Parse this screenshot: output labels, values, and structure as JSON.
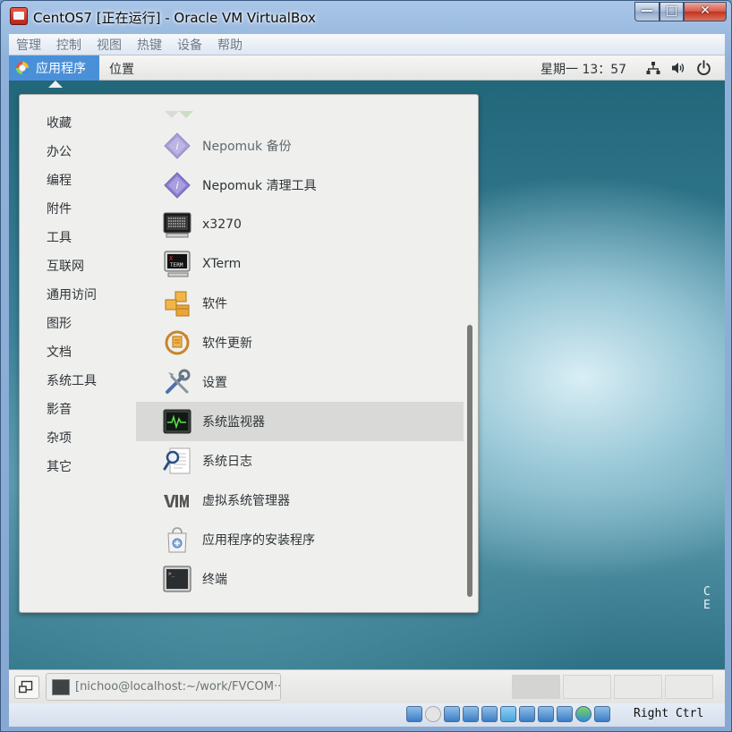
{
  "window": {
    "title": "CentOS7 [正在运行] - Oracle VM VirtualBox",
    "controls": {
      "minimize": "—",
      "maximize": "□",
      "close": "✕"
    }
  },
  "vbox_menu": [
    "管理",
    "控制",
    "视图",
    "热键",
    "设备",
    "帮助"
  ],
  "top_panel": {
    "applications": "应用程序",
    "places": "位置",
    "clock": "星期一 13：57",
    "icons": [
      "network-icon",
      "volume-icon",
      "power-icon"
    ]
  },
  "categories": [
    "收藏",
    "办公",
    "编程",
    "附件",
    "工具",
    "互联网",
    "通用访问",
    "图形",
    "文档",
    "系统工具",
    "影音",
    "杂项",
    "其它"
  ],
  "apps": [
    {
      "label": "Nepomuk 备份",
      "icon": "nepomuk-icon"
    },
    {
      "label": "Nepomuk 清理工具",
      "icon": "nepomuk-icon"
    },
    {
      "label": "x3270",
      "icon": "x3270-terminal-icon"
    },
    {
      "label": "XTerm",
      "icon": "xterm-icon"
    },
    {
      "label": "软件",
      "icon": "software-packages-icon"
    },
    {
      "label": "软件更新",
      "icon": "software-update-icon"
    },
    {
      "label": "设置",
      "icon": "settings-tools-icon"
    },
    {
      "label": "系统监视器",
      "icon": "system-monitor-icon"
    },
    {
      "label": "系统日志",
      "icon": "system-log-icon"
    },
    {
      "label": "虚拟系统管理器",
      "icon": "virt-manager-icon"
    },
    {
      "label": "应用程序的安装程序",
      "icon": "app-installer-icon"
    },
    {
      "label": "终端",
      "icon": "terminal-icon"
    }
  ],
  "selected_app": "系统监视器",
  "watermark": "C E",
  "bottom_panel": {
    "task_label": "[nichoo@localhost:~/work/FVCOM···",
    "workspace_count": 4,
    "active_workspace": 1
  },
  "vbox_status": {
    "host_key": "Right Ctrl"
  },
  "colors": {
    "accent": "#4a90d9",
    "selection": "#d9d9d7",
    "menu_bg": "#efefee"
  }
}
